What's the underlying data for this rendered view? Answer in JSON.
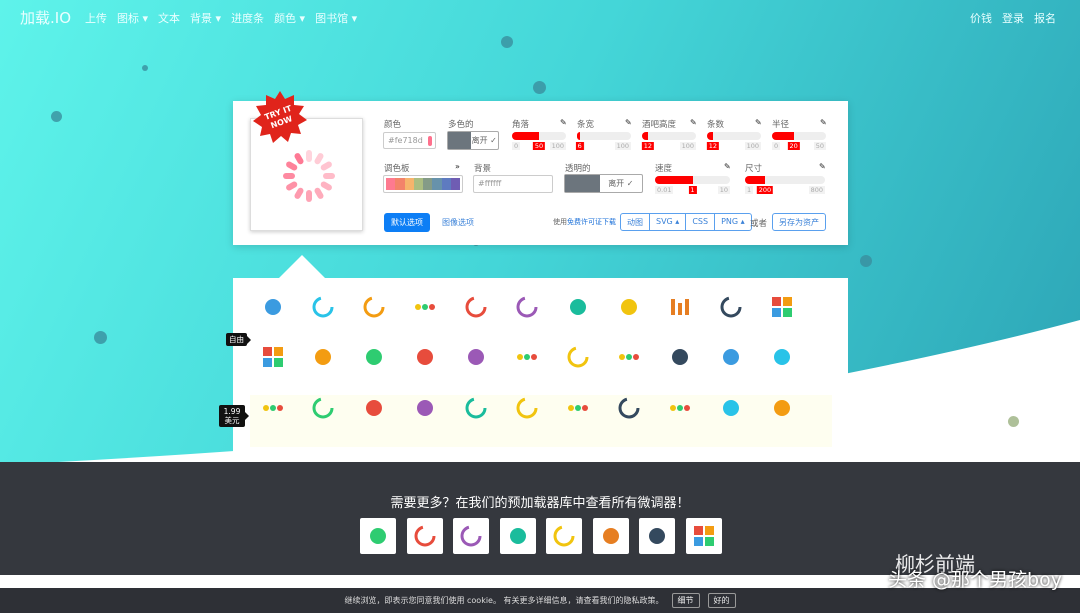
{
  "nav": {
    "brand": "加载.IO",
    "items": [
      "上传",
      "图标 ▾",
      "文本",
      "背景 ▾",
      "进度条",
      "颜色 ▾",
      "图书馆 ▾"
    ],
    "right": [
      "价钱",
      "登录",
      "报名"
    ]
  },
  "badge": "TRY IT NOW",
  "editor": {
    "color": {
      "label": "颜色",
      "value": "#fe718d",
      "swatch": "#fe718d"
    },
    "multicolor": {
      "label": "多色的",
      "state": "离开 ✓"
    },
    "sliders": [
      {
        "label": "角落",
        "min": "0",
        "max": "100",
        "value": "50",
        "fraction": 0.5
      },
      {
        "label": "条宽",
        "min": "1",
        "max": "100",
        "value": "6",
        "fraction": 0.05
      },
      {
        "label": "酒吧高度",
        "min": "1",
        "max": "100",
        "value": "12",
        "fraction": 0.11
      },
      {
        "label": "条数",
        "min": "1",
        "max": "100",
        "value": "12",
        "fraction": 0.11
      },
      {
        "label": "半径",
        "min": "0",
        "max": "50",
        "value": "20",
        "fraction": 0.4
      }
    ],
    "palette": {
      "label": "调色板",
      "colors": [
        "#fe7a90",
        "#f3836a",
        "#f6b46c",
        "#abbd81",
        "#849b87",
        "#6792ab",
        "#5e7bc0",
        "#6f5db3"
      ]
    },
    "background": {
      "label": "背景",
      "value": "#ffffff"
    },
    "transparent": {
      "label": "透明的",
      "state": "离开 ✓"
    },
    "speed": {
      "label": "速度",
      "min": "0.01",
      "max": "10",
      "value": "1",
      "fraction": 0.5
    },
    "size": {
      "label": "尺寸",
      "min": "1",
      "max": "800",
      "value": "200",
      "fraction": 0.25
    },
    "default_btn": "默认选项",
    "image_btn": "图像选项",
    "license_prefix": "使用",
    "license_link": "免费许可证下载",
    "downloads": [
      "动图",
      "SVG ▴",
      "CSS",
      "PNG ▴"
    ],
    "or": "或者",
    "save_asset": "另存为资产"
  },
  "tags": {
    "free": "自由",
    "paid": "1.99 美元"
  },
  "icons": [
    [
      "spinner",
      "ring-partial",
      "ring-blue",
      "dots-cyan",
      "ring-cyan",
      "ring-green",
      "infinity",
      "gear",
      "bars-blue",
      "ring-red",
      "blocks"
    ],
    [
      "grid-blue",
      "ball-bounce",
      "pacman",
      "pie",
      "orb-orange",
      "dots-flickr",
      "ring-black",
      "dots-colors",
      "search",
      "triangle",
      "wifi"
    ],
    [
      "dots-ellipse",
      "dot-ring",
      "gears",
      "hourglass",
      "donut",
      "rainbow-ring",
      "arc-dots",
      "spiral",
      "dots-line",
      "globe",
      "fidget"
    ]
  ],
  "footer": {
    "title": "需要更多？在我们的预加载器库中查看所有微调器！",
    "tiles": [
      "flask",
      "color-ring",
      "ring-light",
      "orb-half",
      "dots-ring",
      "hand",
      "bread",
      "pixel-blocks"
    ]
  },
  "cookie": {
    "text": "继续浏览，即表示您同意我们使用 cookie。 有关更多详细信息，请查看我们的隐私政策。",
    "details": "细节",
    "ok": "好的"
  },
  "watermark": {
    "text": "头条 @那个男孩boy",
    "account": "柳杉前端"
  }
}
